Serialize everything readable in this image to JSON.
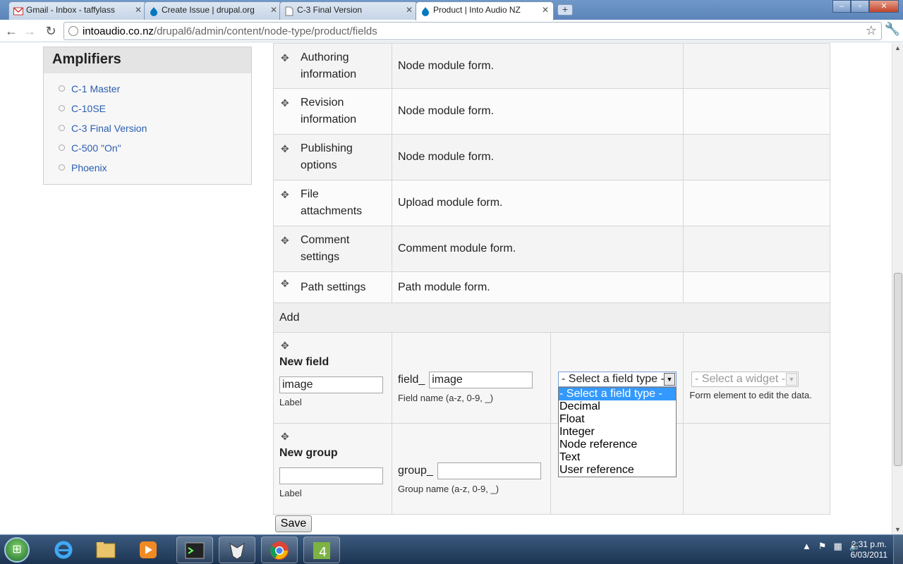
{
  "browser": {
    "tabs": [
      {
        "title": "Gmail - Inbox - taffylass",
        "icon": "gmail-icon"
      },
      {
        "title": "Create Issue | drupal.org",
        "icon": "drupal-icon"
      },
      {
        "title": "C-3 Final Version",
        "icon": "document-icon"
      },
      {
        "title": "Product | Into Audio NZ",
        "icon": "drupal-icon",
        "active": true
      }
    ],
    "url_host": "intoaudio.co.nz",
    "url_path": "/drupal6/admin/content/node-type/product/fields"
  },
  "sidebar": {
    "title": "Amplifiers",
    "items": [
      {
        "label": "C-1 Master"
      },
      {
        "label": "C-10SE"
      },
      {
        "label": "C-3 Final Version"
      },
      {
        "label": "C-500 \"On\""
      },
      {
        "label": "Phoenix"
      }
    ]
  },
  "fields": {
    "rows": [
      {
        "name_line1": "Authoring",
        "name_line2": "information",
        "desc": "Node module form."
      },
      {
        "name_line1": "Revision",
        "name_line2": "information",
        "desc": "Node module form."
      },
      {
        "name_line1": "Publishing",
        "name_line2": "options",
        "desc": "Node module form."
      },
      {
        "name_line1": "File",
        "name_line2": "attachments",
        "desc": "Upload module form."
      },
      {
        "name_line1": "Comment",
        "name_line2": "settings",
        "desc": "Comment module form."
      },
      {
        "name_line1": "Path settings",
        "name_line2": "",
        "desc": "Path module form."
      }
    ],
    "add_label": "Add",
    "new_field": {
      "title": "New field",
      "label_value": "image",
      "label_caption": "Label",
      "prefix": "field_",
      "name_value": "image",
      "name_caption": "Field name (a-z, 0-9, _)",
      "type_selected": "- Select a field type -",
      "type_options": [
        "- Select a field type -",
        "Decimal",
        "Float",
        "Integer",
        "Node reference",
        "Text",
        "User reference"
      ],
      "widget_selected": "- Select a widget -",
      "widget_caption": "Form element to edit the data."
    },
    "new_group": {
      "title": "New group",
      "label_value": "",
      "label_caption": "Label",
      "prefix": "group_",
      "name_value": "",
      "name_caption": "Group name (a-z, 0-9, _)"
    },
    "save_label": "Save"
  },
  "taskbar": {
    "apps": [
      "internet-explorer-icon",
      "explorer-folder-icon",
      "media-player-icon",
      "terminal-icon",
      "foxit-icon",
      "chrome-icon",
      "app-4-icon"
    ],
    "time": "2:31 p.m.",
    "date": "6/03/2011"
  },
  "colors": {
    "link": "#2a5db0",
    "selection": "#3399ff"
  }
}
